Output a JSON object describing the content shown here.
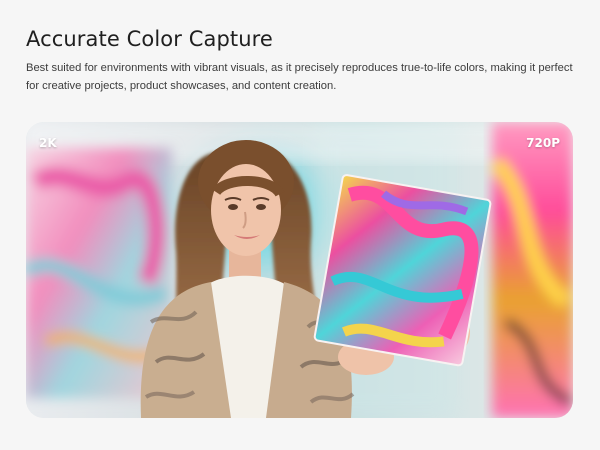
{
  "hero": {
    "title": "Accurate Color Capture",
    "description": "Best suited for environments with vibrant visuals, as it precisely reproduces true-to-life colors, making it perfect for creative projects, product showcases, and content creation.",
    "left_resolution": "2K",
    "right_resolution": "720P"
  },
  "colors": {
    "background": "#f6f6f6",
    "title": "#202020",
    "body_text": "#3c3c3c",
    "label_text": "#ffffff"
  }
}
